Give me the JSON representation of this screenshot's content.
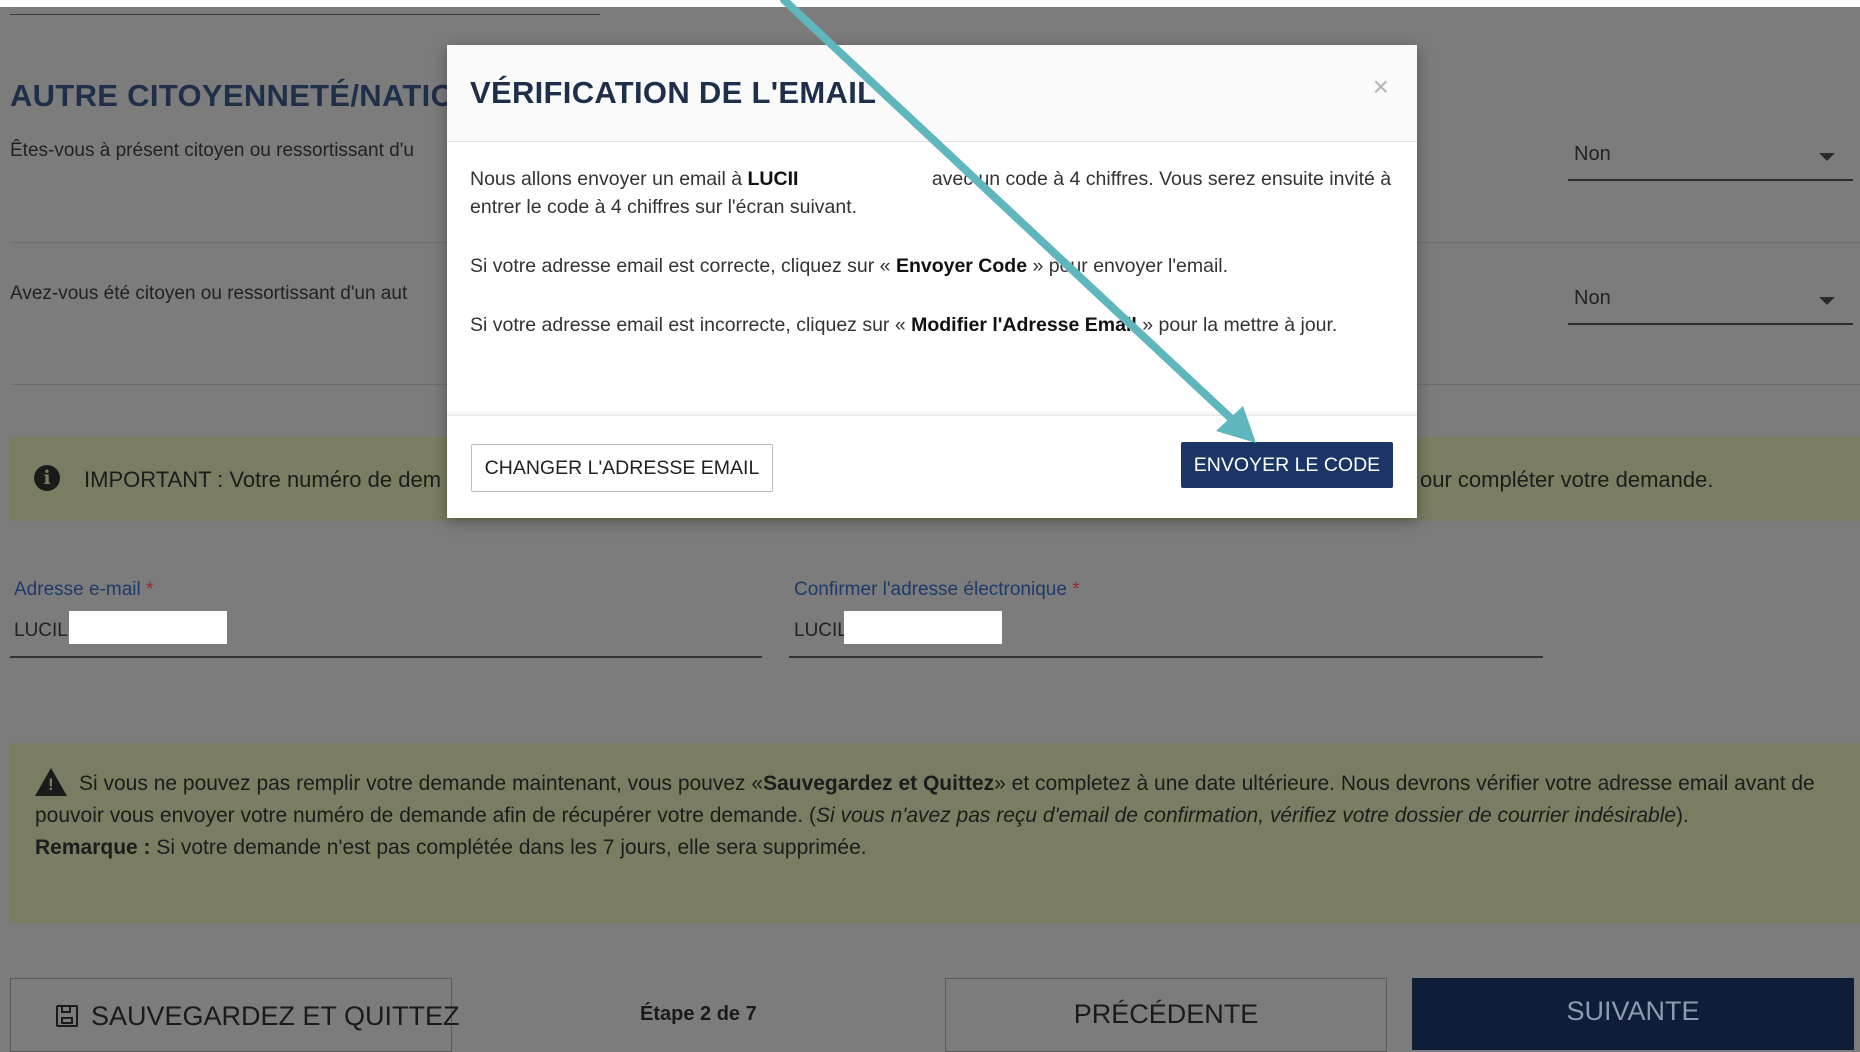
{
  "section": {
    "title": "AUTRE CITOYENNETÉ/NATION",
    "q1": "Êtes-vous à présent citoyen ou ressortissant d'u",
    "q1_answer": "Non",
    "q2": "Avez-vous été citoyen ou ressortissant d'un aut",
    "q2_answer": "Non"
  },
  "important": {
    "left": "IMPORTANT : Votre numéro de dem",
    "right": "our compléter votre demande."
  },
  "email_field": {
    "label": "Adresse e-mail",
    "required": "*",
    "value": "LUCIL"
  },
  "confirm_field": {
    "label": "Confirmer l'adresse électronique",
    "required": "*",
    "value": "LUCIL"
  },
  "warning": {
    "t1": "Si vous ne pouvez pas remplir votre demande maintenant, vous pouvez «",
    "b1": "Sauvegardez et Quittez",
    "t2": "» et completez à une date ultérieure. Nous devrons vérifier votre adresse email avant de pouvoir vous envoyer votre numéro de demande afin de récupérer votre demande. (",
    "i1": "Si vous n'avez pas reçu d'email de confirmation, vérifiez votre dossier de courrier indésirable",
    "t3": ").",
    "remark_label": "Remarque :",
    "remark": " Si votre demande n'est pas complétée dans les 7 jours, elle sera supprimée."
  },
  "footer": {
    "save_quit": "SAUVEGARDEZ ET QUITTEZ",
    "step": "Étape 2 de 7",
    "prev": "PRÉCÉDENTE",
    "next": "SUIVANTE"
  },
  "modal": {
    "title": "VÉRIFICATION DE L'EMAIL",
    "close": "×",
    "p1_a": "Nous allons envoyer un email à ",
    "p1_b": "LUCII",
    "p1_c": " avec un code à 4 chiffres. Vous serez ensuite invité à entrer le code à 4 chiffres sur l'écran suivant.",
    "p2_a": "Si votre adresse email est correcte, cliquez sur « ",
    "p2_b": "Envoyer Code",
    "p2_c": " » pour envoyer l'email.",
    "p3_a": "Si votre adresse email est incorrecte, cliquez sur « ",
    "p3_b": "Modifier l'Adresse Email",
    "p3_c": " » pour la mettre à jour.",
    "change_email": "CHANGER L'ADRESSE EMAIL",
    "send_code": "ENVOYER LE CODE"
  },
  "colors": {
    "overlay": "#7c7c7c",
    "brand_navy": "#1b3566",
    "notice": "#7b7d62",
    "arrow": "#5fb6bd"
  }
}
